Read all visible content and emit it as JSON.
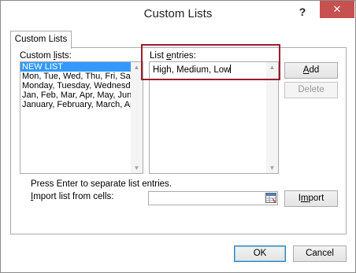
{
  "window": {
    "title": "Custom Lists",
    "help_label": "?",
    "close_label": "✕"
  },
  "tab": {
    "label": "Custom Lists"
  },
  "custom_lists": {
    "label_pre": "Custom ",
    "label_key": "l",
    "label_post": "ists:",
    "items": [
      "NEW LIST",
      "Mon, Tue, Wed, Thu, Fri, Sat, S",
      "Monday, Tuesday, Wednesday,",
      "Jan, Feb, Mar, Apr, May, Jun, Ju",
      "January, February, March, Apri"
    ],
    "selected_index": 0
  },
  "entries": {
    "label_pre": "List ",
    "label_key": "e",
    "label_post": "ntries:",
    "value": "High, Medium, Low"
  },
  "buttons": {
    "add_key": "A",
    "add_rest": "dd",
    "delete": "Delete",
    "import_key": "m",
    "import_pre": "I",
    "import_post": "port",
    "ok": "OK",
    "cancel": "Cancel"
  },
  "import": {
    "hint": "Press Enter to separate list entries.",
    "label_key": "I",
    "label_post": "mport list from cells:",
    "value": ""
  },
  "icons": {
    "range_selector": "range-selector-icon",
    "scroll_up": "scroll-up-icon",
    "scroll_down": "scroll-down-icon"
  },
  "colors": {
    "selection": "#3399ff",
    "close_button": "#c75050",
    "highlight_border": "#9b1b2e"
  }
}
